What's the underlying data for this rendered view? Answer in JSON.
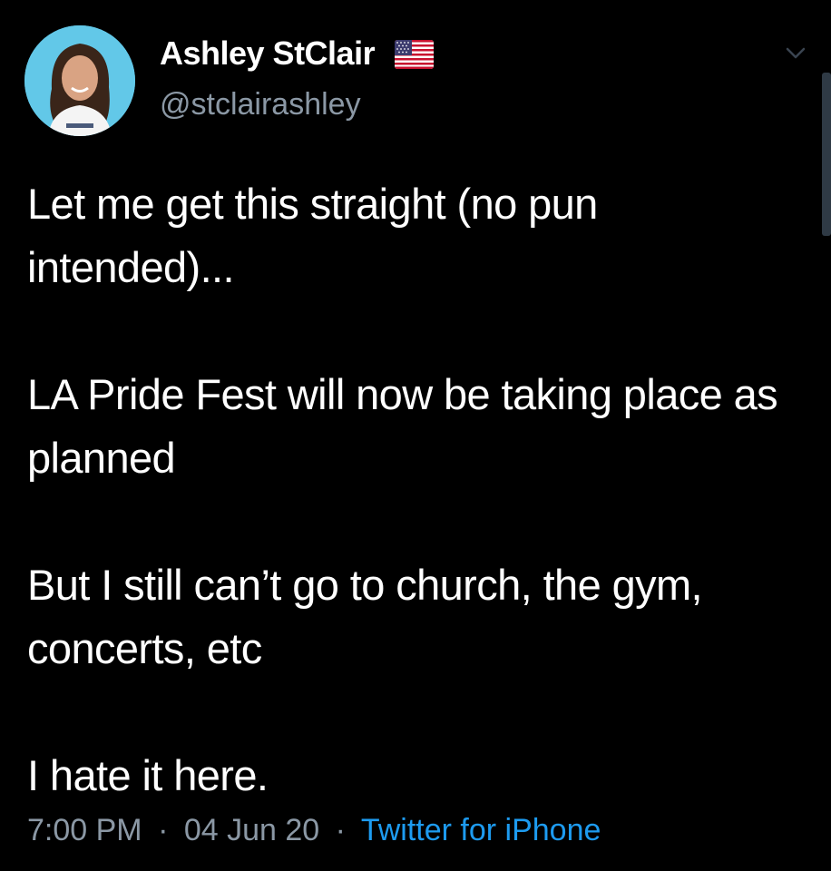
{
  "user": {
    "display_name": "Ashley StClair",
    "handle": "@stclairashley",
    "badge_icon": "us-flag-icon"
  },
  "tweet": {
    "paragraphs": [
      "Let me get this straight (no pun intended)...",
      "LA Pride Fest will now be taking place as planned",
      "But I still can’t go to church, the gym, concerts, etc",
      "I hate it here."
    ]
  },
  "meta": {
    "time": "7:00 PM",
    "date": "04 Jun 20",
    "separator": "·",
    "source": "Twitter for iPhone"
  },
  "colors": {
    "background": "#000000",
    "text": "#ffffff",
    "secondary": "#8b98a5",
    "link": "#1d9bf0"
  },
  "icons": {
    "menu": "chevron-down-icon"
  }
}
